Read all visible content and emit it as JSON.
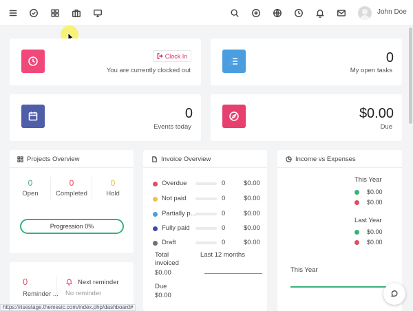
{
  "topbar": {
    "user_name": "John Doe",
    "icons_left": [
      "menu-icon",
      "check-circle-icon",
      "grid-icon",
      "briefcase-icon",
      "monitor-icon"
    ],
    "icons_right": [
      "search-icon",
      "plus-circle-icon",
      "globe-icon",
      "clock-icon",
      "bell-icon",
      "mail-icon"
    ]
  },
  "clock_card": {
    "button_label": "Clock In",
    "status_text": "You are currently clocked out",
    "accent": "#f1487a"
  },
  "tasks_card": {
    "value": "0",
    "label": "My open tasks",
    "accent": "#4a9ee0"
  },
  "events_card": {
    "value": "0",
    "label": "Events today",
    "accent": "#4f5ea8"
  },
  "due_card": {
    "value": "$0.00",
    "label": "Due",
    "accent": "#e73f70"
  },
  "projects": {
    "title": "Projects Overview",
    "stats": [
      {
        "value": "0",
        "label": "Open",
        "color": "#38b27a"
      },
      {
        "value": "0",
        "label": "Completed",
        "color": "#e24b64"
      },
      {
        "value": "0",
        "label": "Hold",
        "color": "#f0b93e"
      }
    ],
    "progression_label": "Progression 0%"
  },
  "reminder": {
    "count": "0",
    "count_label": "Reminder ...",
    "next_label": "Next reminder",
    "next_value": "No reminder"
  },
  "invoice": {
    "title": "Invoice Overview",
    "rows": [
      {
        "label": "Overdue",
        "count": "0",
        "amount": "$0.00",
        "color": "#e24b64"
      },
      {
        "label": "Not paid",
        "count": "0",
        "amount": "$0.00",
        "color": "#f0c14b"
      },
      {
        "label": "Partially p...",
        "count": "0",
        "amount": "$0.00",
        "color": "#4a9ee0"
      },
      {
        "label": "Fully paid",
        "count": "0",
        "amount": "$0.00",
        "color": "#3d4ca0"
      },
      {
        "label": "Draft",
        "count": "0",
        "amount": "$0.00",
        "color": "#6e6f74"
      }
    ],
    "total_label": "Total invoiced",
    "total_value": "$0.00",
    "due_label": "Due",
    "due_value": "$0.00",
    "period_label": "Last 12 months"
  },
  "income": {
    "title": "Income vs Expenses",
    "groups": [
      {
        "heading": "This Year",
        "income": "$0.00",
        "expenses": "$0.00"
      },
      {
        "heading": "Last Year",
        "income": "$0.00",
        "expenses": "$0.00"
      }
    ],
    "chart_label": "This Year",
    "income_color": "#38b27a",
    "expense_color": "#e24b64"
  },
  "statusbar": {
    "url": "https://risestage.themesic.com/index.php/dashboard#"
  }
}
